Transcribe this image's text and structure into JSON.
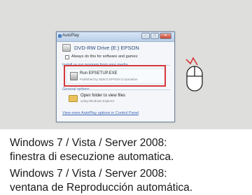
{
  "autoplay_window": {
    "title": "AutoPlay",
    "drive_title": "DVD-RW Drive (E:) EPSON",
    "always_checkbox_label": "Always do this for software and games:",
    "install_section_label": "Install or run program from your media",
    "run_item": {
      "label": "Run EPSETUP.EXE",
      "sub": "Published by SEIKO EPSON Corporation"
    },
    "general_section_label": "General options",
    "open_folder_item": {
      "label": "Open folder to view files",
      "sub": "using Windows Explorer"
    },
    "control_panel_link": "View more AutoPlay options in Control Panel"
  },
  "captions": [
    "Windows 7 / Vista / Server 2008:",
    "finestra di esecuzione automatica.",
    "Windows 7 / Vista / Server 2008:",
    "ventana de Reproducción automática."
  ],
  "colors": {
    "highlight": "#d6373b",
    "panel_bg": "#dededc",
    "click_marks": "#d6373b"
  }
}
